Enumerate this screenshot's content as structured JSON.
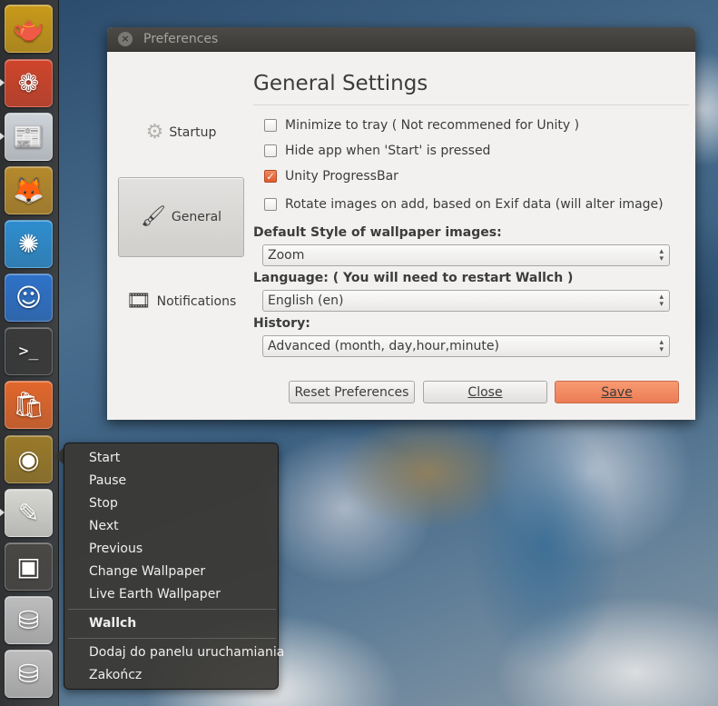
{
  "launcher": {
    "items": [
      {
        "name": "teapot-app-icon",
        "symbol": "🫖",
        "bg": "#c99a1a",
        "pip": false
      },
      {
        "name": "color-wheel-app-icon",
        "symbol": "❁",
        "bg": "#d0452b",
        "pip": true
      },
      {
        "name": "news-app-icon",
        "symbol": "📰",
        "bg": "#cfd4da",
        "pip": true
      },
      {
        "name": "gimp-app-icon",
        "symbol": "🦊",
        "bg": "#b68a2c",
        "pip": false
      },
      {
        "name": "shutter-app-icon",
        "symbol": "✺",
        "bg": "#2f8ed0",
        "pip": false
      },
      {
        "name": "chat-app-icon",
        "symbol": "☺",
        "bg": "#2e72c8",
        "pip": false
      },
      {
        "name": "terminal-app-icon",
        "symbol": ">_",
        "bg": "#3a3a3a",
        "pip": false
      },
      {
        "name": "software-center-app-icon",
        "symbol": "🛍",
        "bg": "#e2672c",
        "pip": false
      },
      {
        "name": "wallch-app-icon",
        "symbol": "◉",
        "bg": "#9a7a2a",
        "pip": false
      },
      {
        "name": "text-editor-app-icon",
        "symbol": "✎",
        "bg": "#d7d7d2",
        "pip": true
      },
      {
        "name": "workspace-switcher-icon",
        "symbol": "▣",
        "bg": "#4a4845",
        "pip": false
      },
      {
        "name": "drive-app-icon",
        "symbol": "⛁",
        "bg": "#bdbdbd",
        "pip": false
      },
      {
        "name": "drive-2-app-icon",
        "symbol": "⛁",
        "bg": "#bdbdbd",
        "pip": false
      }
    ]
  },
  "window": {
    "title": "Preferences",
    "close_symbol": "×",
    "nav": [
      {
        "key": "startup",
        "label": "Startup",
        "icon": "⚙"
      },
      {
        "key": "general",
        "label": "General",
        "icon": "🖌"
      },
      {
        "key": "notifications",
        "label": "Notifications",
        "icon": "🎞"
      }
    ],
    "heading": "General Settings",
    "checkboxes": [
      {
        "label": "Minimize to tray ( Not recommened for Unity )",
        "checked": false
      },
      {
        "label": "Hide app when 'Start' is pressed",
        "checked": false
      },
      {
        "label": "Unity ProgressBar",
        "checked": true
      },
      {
        "label": "Rotate images on add, based on Exif data (will alter image)",
        "checked": false
      }
    ],
    "wallpaper_style_label": "Default Style of wallpaper images:",
    "wallpaper_style_value": "Zoom",
    "language_label": "Language: ( You will need to restart Wallch )",
    "language_value": "English (en)",
    "history_label": "History:",
    "history_value": "Advanced (month, day,hour,minute)",
    "buttons": {
      "reset": "Reset Preferences",
      "close": "Close",
      "save": "Save"
    }
  },
  "menu": {
    "items": [
      "Start",
      "Pause",
      "Stop",
      "Next",
      "Previous",
      "Change Wallpaper",
      "Live Earth Wallpaper"
    ],
    "app_name": "Wallch",
    "extra_items": [
      "Dodaj do panelu uruchamiania",
      "Zakończ"
    ]
  }
}
